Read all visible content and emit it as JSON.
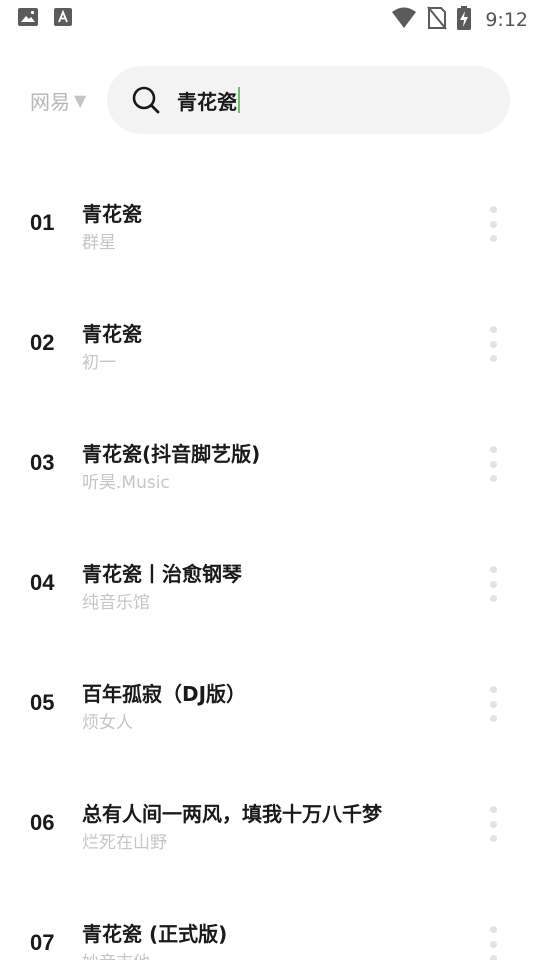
{
  "status_bar": {
    "time": "9:12",
    "icons": [
      "image-icon",
      "text-a-icon",
      "wifi-icon",
      "no-sim-icon",
      "battery-charging-icon"
    ]
  },
  "header": {
    "source_label": "网易",
    "search_query": "青花瓷"
  },
  "results": [
    {
      "num": "01",
      "title": "青花瓷",
      "artist": "群星"
    },
    {
      "num": "02",
      "title": "青花瓷",
      "artist": "初一"
    },
    {
      "num": "03",
      "title": "青花瓷(抖音脚艺版)",
      "artist": "听昊.Music"
    },
    {
      "num": "04",
      "title": "青花瓷丨治愈钢琴",
      "artist": "纯音乐馆"
    },
    {
      "num": "05",
      "title": "百年孤寂（DJ版）",
      "artist": "烦女人"
    },
    {
      "num": "06",
      "title": "总有人间一两风，填我十万八千梦",
      "artist": "烂死在山野"
    },
    {
      "num": "07",
      "title": "青花瓷 (正式版)",
      "artist": "妙音吉他"
    }
  ]
}
